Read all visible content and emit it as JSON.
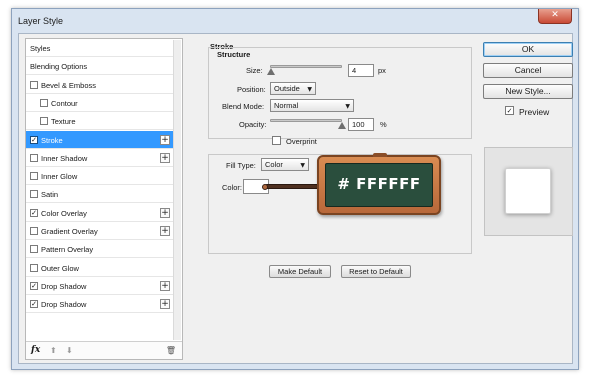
{
  "window": {
    "title": "Layer Style",
    "close_glyph": "✕"
  },
  "styles_list": {
    "items": [
      {
        "label": "Styles",
        "has_checkbox": false,
        "checked": false,
        "has_plus": false,
        "indent": 0,
        "selected": false
      },
      {
        "label": "Blending Options",
        "has_checkbox": false,
        "checked": false,
        "has_plus": false,
        "indent": 0,
        "selected": false
      },
      {
        "label": "Bevel & Emboss",
        "has_checkbox": true,
        "checked": false,
        "has_plus": false,
        "indent": 0,
        "selected": false
      },
      {
        "label": "Contour",
        "has_checkbox": true,
        "checked": false,
        "has_plus": false,
        "indent": 1,
        "selected": false
      },
      {
        "label": "Texture",
        "has_checkbox": true,
        "checked": false,
        "has_plus": false,
        "indent": 1,
        "selected": false
      },
      {
        "label": "Stroke",
        "has_checkbox": true,
        "checked": true,
        "has_plus": true,
        "indent": 0,
        "selected": true
      },
      {
        "label": "Inner Shadow",
        "has_checkbox": true,
        "checked": false,
        "has_plus": true,
        "indent": 0,
        "selected": false
      },
      {
        "label": "Inner Glow",
        "has_checkbox": true,
        "checked": false,
        "has_plus": false,
        "indent": 0,
        "selected": false
      },
      {
        "label": "Satin",
        "has_checkbox": true,
        "checked": false,
        "has_plus": false,
        "indent": 0,
        "selected": false
      },
      {
        "label": "Color Overlay",
        "has_checkbox": true,
        "checked": true,
        "has_plus": true,
        "indent": 0,
        "selected": false
      },
      {
        "label": "Gradient Overlay",
        "has_checkbox": true,
        "checked": false,
        "has_plus": true,
        "indent": 0,
        "selected": false
      },
      {
        "label": "Pattern Overlay",
        "has_checkbox": true,
        "checked": false,
        "has_plus": false,
        "indent": 0,
        "selected": false
      },
      {
        "label": "Outer Glow",
        "has_checkbox": true,
        "checked": false,
        "has_plus": false,
        "indent": 0,
        "selected": false
      },
      {
        "label": "Drop Shadow",
        "has_checkbox": true,
        "checked": true,
        "has_plus": true,
        "indent": 0,
        "selected": false
      },
      {
        "label": "Drop Shadow",
        "has_checkbox": true,
        "checked": true,
        "has_plus": true,
        "indent": 0,
        "selected": false
      }
    ],
    "footer": {
      "fx_label": "fx",
      "up_glyph": "⬆",
      "down_glyph": "⬇",
      "trash_glyph": "🗑"
    }
  },
  "stroke": {
    "section_title": "Stroke",
    "structure_title": "Structure",
    "size_label": "Size:",
    "size_value": "4",
    "size_unit": "px",
    "size_fraction": 0.02,
    "position_label": "Position:",
    "position_value": "Outside",
    "blend_mode_label": "Blend Mode:",
    "blend_mode_value": "Normal",
    "opacity_label": "Opacity:",
    "opacity_value": "100",
    "opacity_unit": "%",
    "opacity_fraction": 1.0,
    "overprint_label": "Overprint",
    "overprint_checked": false,
    "fill_type_label": "Fill Type:",
    "fill_type_value": "Color",
    "color_label": "Color:",
    "color_value": "#ffffff",
    "make_default_label": "Make Default",
    "reset_default_label": "Reset to Default"
  },
  "callout": {
    "text": "# FFFFFF"
  },
  "actions": {
    "ok_label": "OK",
    "cancel_label": "Cancel",
    "new_style_label": "New Style...",
    "preview_label": "Preview",
    "preview_checked": true
  },
  "colors": {
    "selection": "#3399ff",
    "chalkboard": "#2a4e3d",
    "wood": "#c97a45"
  }
}
